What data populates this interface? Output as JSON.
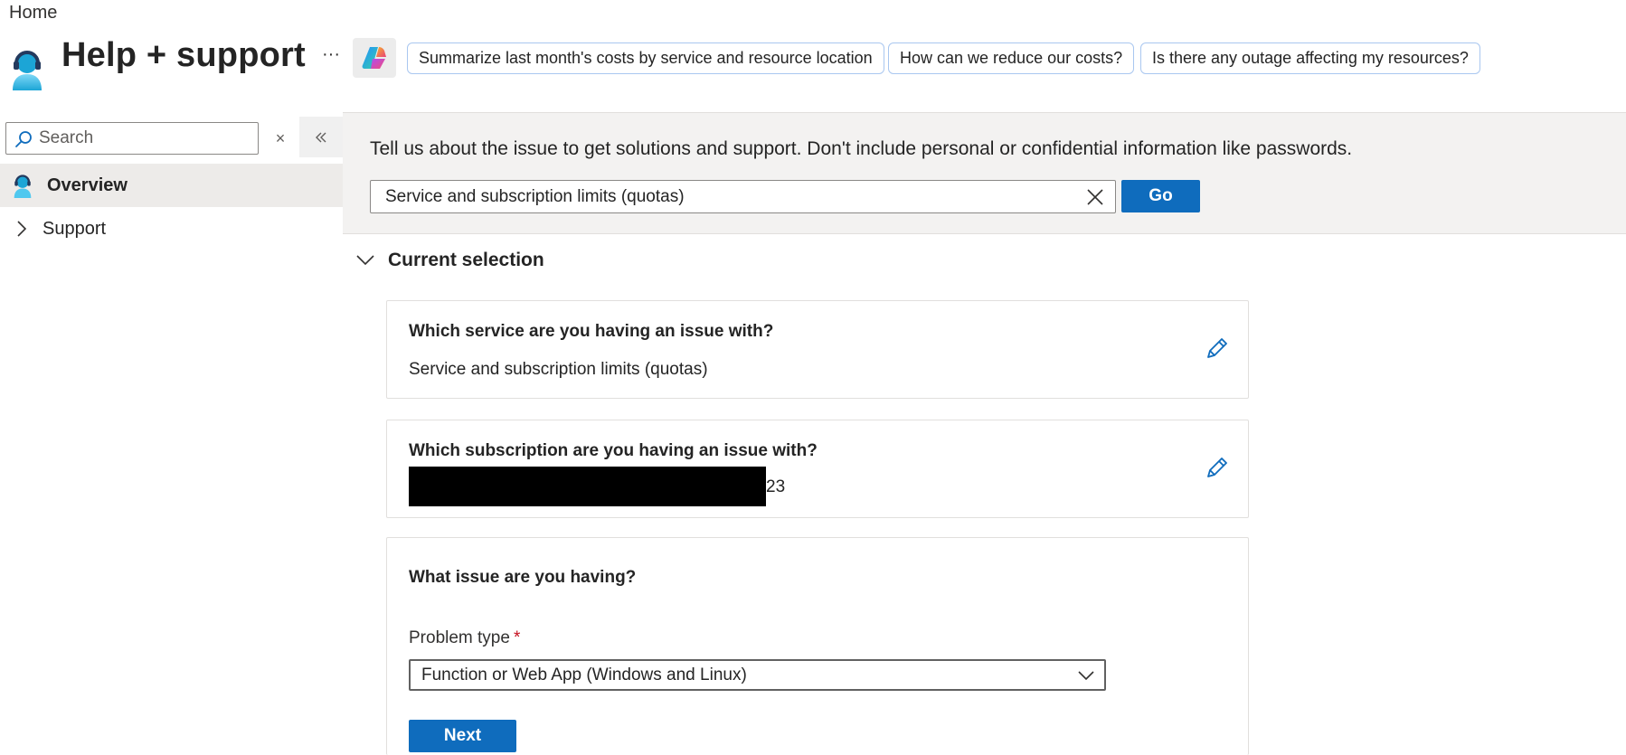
{
  "breadcrumb": {
    "home": "Home"
  },
  "page": {
    "title": "Help + support",
    "icon": "support-person-icon",
    "more": "···"
  },
  "copilot": {
    "icon": "copilot-icon",
    "suggestions": [
      "Summarize last month's costs by service and resource location",
      "How can we reduce our costs?",
      "Is there any outage affecting my resources?"
    ]
  },
  "sidebar": {
    "search_placeholder": "Search",
    "clear_glyph": "×",
    "items": [
      {
        "label": "Overview",
        "icon": "support-person-icon",
        "active": true
      },
      {
        "label": "Support",
        "icon": "chevron-right-icon",
        "active": false
      }
    ]
  },
  "banner": {
    "instruction": "Tell us about the issue to get solutions and support. Don't include personal or confidential information like passwords.",
    "input_value": "Service and subscription limits (quotas)",
    "go_label": "Go"
  },
  "selection": {
    "header": "Current selection",
    "service": {
      "question": "Which service are you having an issue with?",
      "answer": "Service and subscription limits (quotas)"
    },
    "subscription": {
      "question": "Which subscription are you having an issue with?",
      "answer_visible_tail": "23"
    },
    "issue": {
      "question": "What issue are you having?",
      "problem_type_label": "Problem type",
      "required_marker": "*",
      "problem_type_value": "Function or Web App (Windows and Linux)",
      "next_label": "Next"
    }
  },
  "colors": {
    "primary": "#0f6cbd",
    "accent_blue": "#0078d4",
    "banner_bg": "#f3f2f1",
    "active_nav_bg": "#edebe9",
    "required": "#c50f1f"
  }
}
